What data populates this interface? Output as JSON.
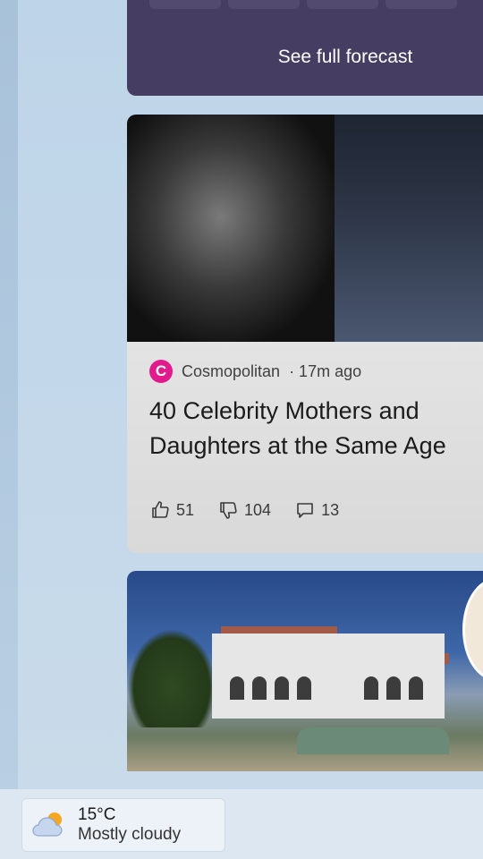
{
  "weather_card": {
    "see_forecast_label": "See full forecast"
  },
  "news": [
    {
      "source_name": "Cosmopolitan",
      "source_logo_letter": "C",
      "source_color": "#e21b8c",
      "time": "· 17m ago",
      "headline": "40 Celebrity Mothers and Daughters at the Same Age",
      "likes": "51",
      "dislikes": "104",
      "comments": "13"
    }
  ],
  "taskbar": {
    "weather_widget": {
      "temperature": "15°C",
      "condition": "Mostly cloudy",
      "icon": "partly-cloudy-icon"
    }
  }
}
